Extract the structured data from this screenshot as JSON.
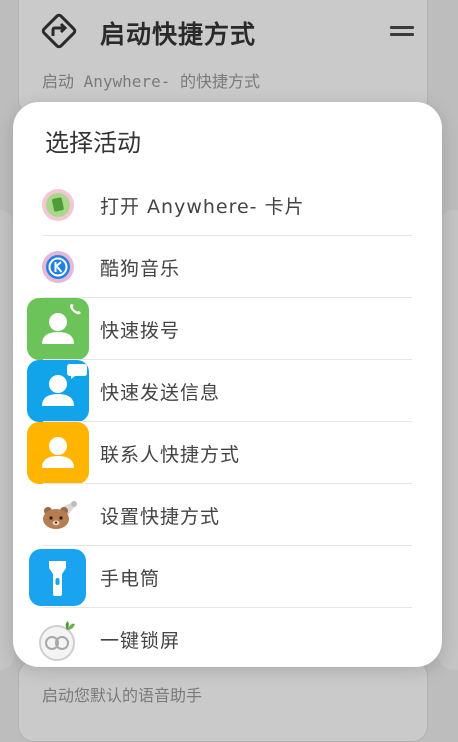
{
  "background": {
    "top_card": {
      "title": "启动快捷方式",
      "subtitle": "启动 Anywhere- 的快捷方式"
    },
    "bottom_card": {
      "subtitle": "启动您默认的语音助手"
    }
  },
  "dialog": {
    "title": "选择活动",
    "items": [
      {
        "label": "打开 Anywhere- 卡片",
        "icon": "anywhere-card-icon"
      },
      {
        "label": "酷狗音乐",
        "icon": "kugou-music-icon"
      },
      {
        "label": "快速拨号",
        "icon": "quick-dial-contact-icon"
      },
      {
        "label": "快速发送信息",
        "icon": "quick-message-contact-icon"
      },
      {
        "label": "联系人快捷方式",
        "icon": "contact-shortcut-icon"
      },
      {
        "label": "设置快捷方式",
        "icon": "bear-settings-icon"
      },
      {
        "label": "手电筒",
        "icon": "flashlight-icon"
      },
      {
        "label": "一键锁屏",
        "icon": "lock-screen-icon"
      }
    ]
  },
  "colors": {
    "dial_green": "#6cc35a",
    "message_blue": "#12a4ea",
    "contact_yellow": "#ffb400",
    "flashlight_blue": "#1aa3ee"
  }
}
